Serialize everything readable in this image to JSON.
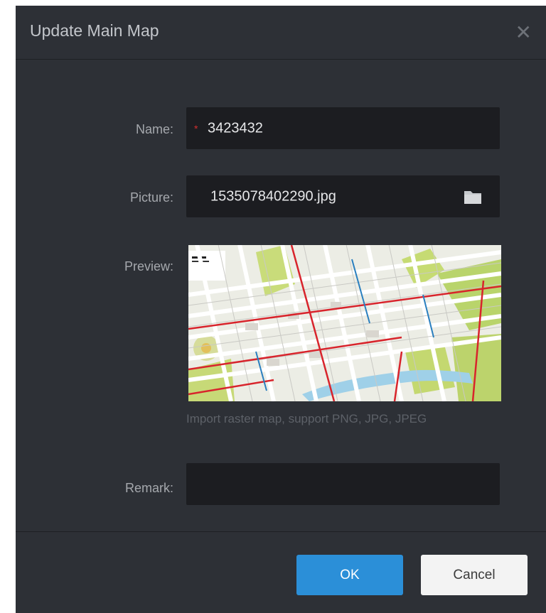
{
  "dialog": {
    "title": "Update Main Map",
    "close_icon": "close-icon"
  },
  "form": {
    "name_label": "Name:",
    "name_required_mark": "*",
    "name_value": "3423432",
    "picture_label": "Picture:",
    "picture_value": "1535078402290.jpg",
    "picture_icon": "folder-icon",
    "preview_label": "Preview:",
    "preview_hint": "Import raster map, support PNG, JPG, JPEG",
    "remark_label": "Remark:",
    "remark_value": ""
  },
  "buttons": {
    "ok_label": "OK",
    "cancel_label": "Cancel"
  },
  "colors": {
    "dialog_bg": "#2d3036",
    "field_bg": "#1c1d21",
    "ok_bg": "#2b8fd8",
    "required": "#d32f2f"
  }
}
